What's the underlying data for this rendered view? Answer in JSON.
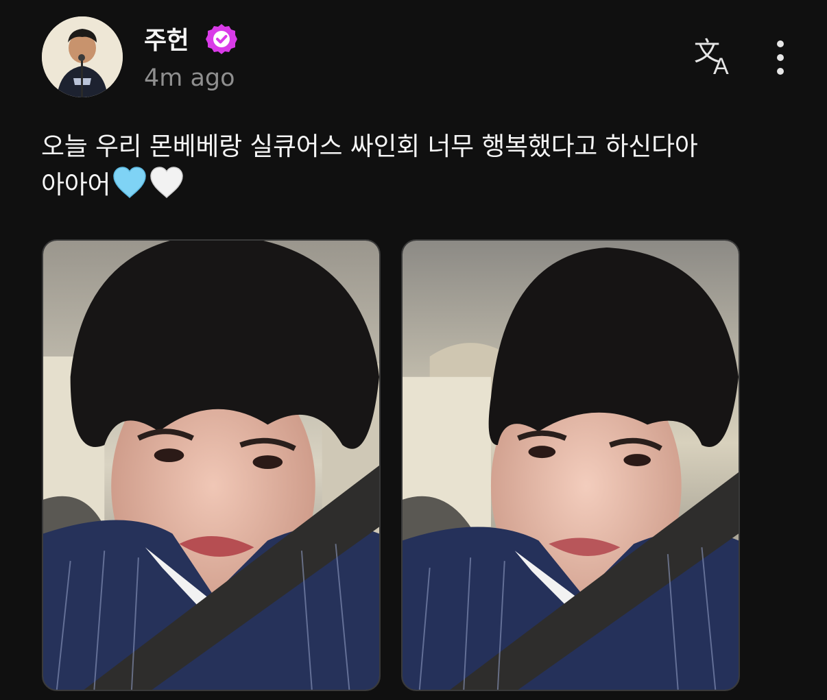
{
  "post": {
    "author": {
      "name": "주헌",
      "verified": true,
      "avatar_icon": "profile-photo"
    },
    "timestamp": "4m ago",
    "actions": {
      "translate_icon": "translate-icon",
      "more_icon": "more-vertical-icon"
    },
    "text": {
      "line1": "오늘 우리 몬베베랑 실큐어스 싸인회 너무 행복했다고 하신다아",
      "line2": "아아어",
      "emojis": [
        "light-blue-heart",
        "white-heart"
      ]
    },
    "photos": [
      {
        "icon": "selfie-photo"
      },
      {
        "icon": "selfie-photo"
      }
    ]
  },
  "colors": {
    "background": "#101010",
    "text": "#f5f5f5",
    "muted": "#8f8f8f",
    "verified_badge": "#d93be8",
    "heart_blue": "#7fd3f5",
    "heart_white": "#f2f2f2"
  }
}
